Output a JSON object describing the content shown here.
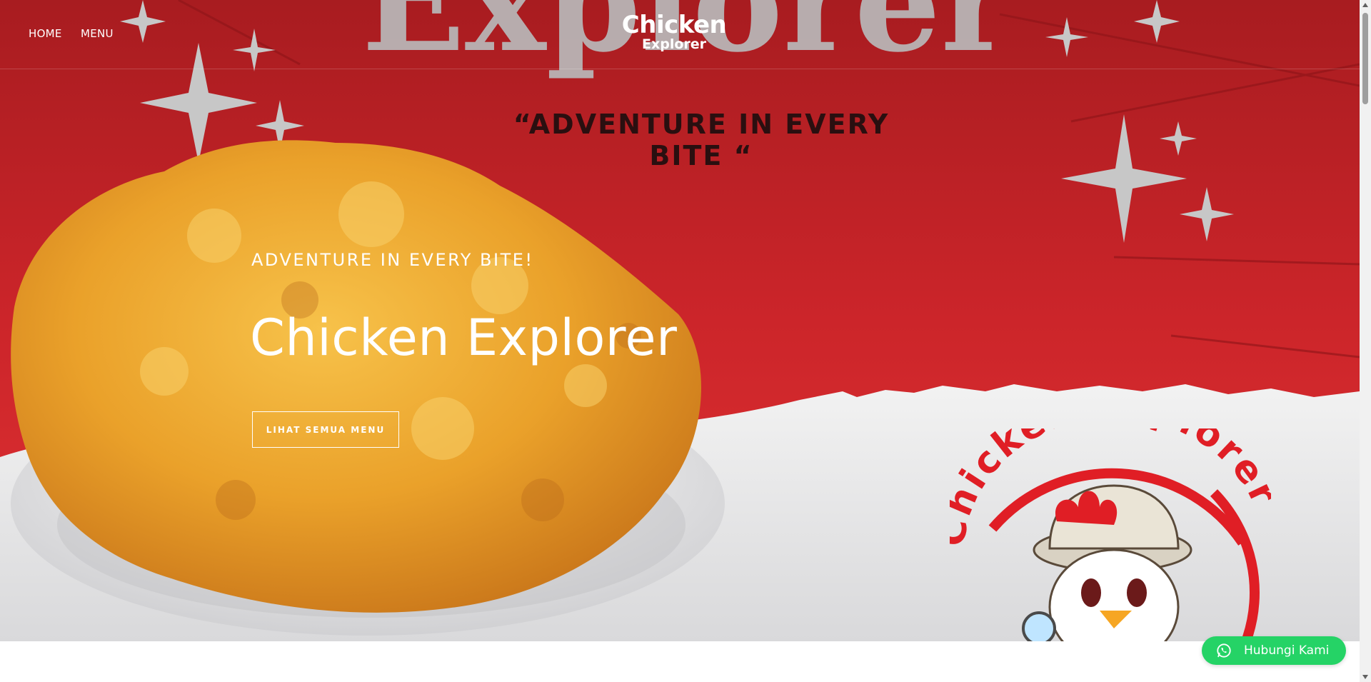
{
  "nav": {
    "home_label": "HOME",
    "menu_label": "MENU",
    "brand_line1": "Chicken",
    "brand_line2": "Explorer"
  },
  "hero": {
    "background_word": "Explorer",
    "tagline": "“ADVENTURE IN EVERY BITE “",
    "eyebrow": "ADVENTURE IN EVERY BITE!",
    "title": "Chicken Explorer",
    "cta_label": "LIHAT SEMUA MENU",
    "logo_text": "Chicken Explorer"
  },
  "whatsapp": {
    "label": "Hubungi Kami",
    "icon": "whatsapp-icon"
  },
  "colors": {
    "hero_red": "#c8242a",
    "whatsapp_green": "#25d366",
    "text_white": "#ffffff"
  }
}
